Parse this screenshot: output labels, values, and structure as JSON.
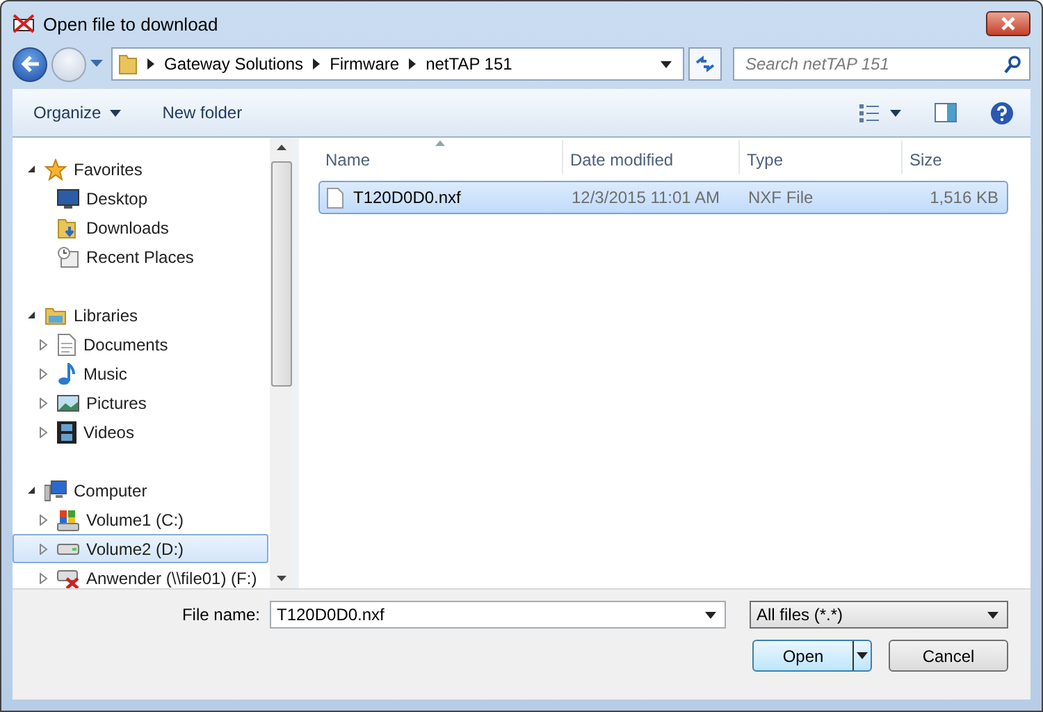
{
  "window": {
    "title": "Open file to download"
  },
  "address_bar": {
    "segments": [
      "Gateway Solutions",
      "Firmware",
      "netTAP 151"
    ]
  },
  "search": {
    "placeholder": "Search netTAP 151"
  },
  "toolbar": {
    "buttons": [
      {
        "label": "Organize",
        "dropdown": true
      },
      {
        "label": "New folder",
        "dropdown": false
      }
    ]
  },
  "sidebar": {
    "sections": [
      {
        "label": "Favorites",
        "kind": "favorites",
        "expanded": true,
        "children": [
          {
            "label": "Desktop",
            "kind": "desktop",
            "selected": false
          },
          {
            "label": "Downloads",
            "kind": "downloads",
            "selected": false
          },
          {
            "label": "Recent Places",
            "kind": "recent",
            "selected": false
          }
        ]
      },
      {
        "label": "Libraries",
        "kind": "libraries",
        "expanded": true,
        "children": [
          {
            "label": "Documents",
            "kind": "documents",
            "expanded": false,
            "selected": false
          },
          {
            "label": "Music",
            "kind": "music",
            "expanded": false,
            "selected": false
          },
          {
            "label": "Pictures",
            "kind": "pictures",
            "expanded": false,
            "selected": false
          },
          {
            "label": "Videos",
            "kind": "videos",
            "expanded": false,
            "selected": false
          }
        ]
      },
      {
        "label": "Computer",
        "kind": "computer",
        "expanded": true,
        "children": [
          {
            "label": "Volume1 (C:)",
            "kind": "system-drive",
            "expanded": false,
            "selected": false
          },
          {
            "label": "Volume2 (D:)",
            "kind": "drive",
            "expanded": false,
            "selected": true
          },
          {
            "label": "Anwender (\\\\file01) (F:)",
            "kind": "network-drive-offline",
            "expanded": false,
            "selected": false
          }
        ]
      }
    ]
  },
  "table": {
    "columns": [
      {
        "label": "Name",
        "sorted": true
      },
      {
        "label": "Date modified",
        "sorted": false
      },
      {
        "label": "Type",
        "sorted": false
      },
      {
        "label": "Size",
        "sorted": false
      }
    ],
    "rows": [
      {
        "name": "T120D0D0.nxf",
        "date_modified": "12/3/2015 11:01 AM",
        "type": "NXF File",
        "size": "1,516 KB",
        "selected": true
      }
    ]
  },
  "file_name": {
    "label": "File name:",
    "value": "T120D0D0.nxf"
  },
  "file_type": {
    "value": "All files (*.*)"
  },
  "buttons": [
    {
      "label": "Open",
      "kind": "split"
    },
    {
      "label": "Cancel",
      "kind": "plain"
    }
  ]
}
